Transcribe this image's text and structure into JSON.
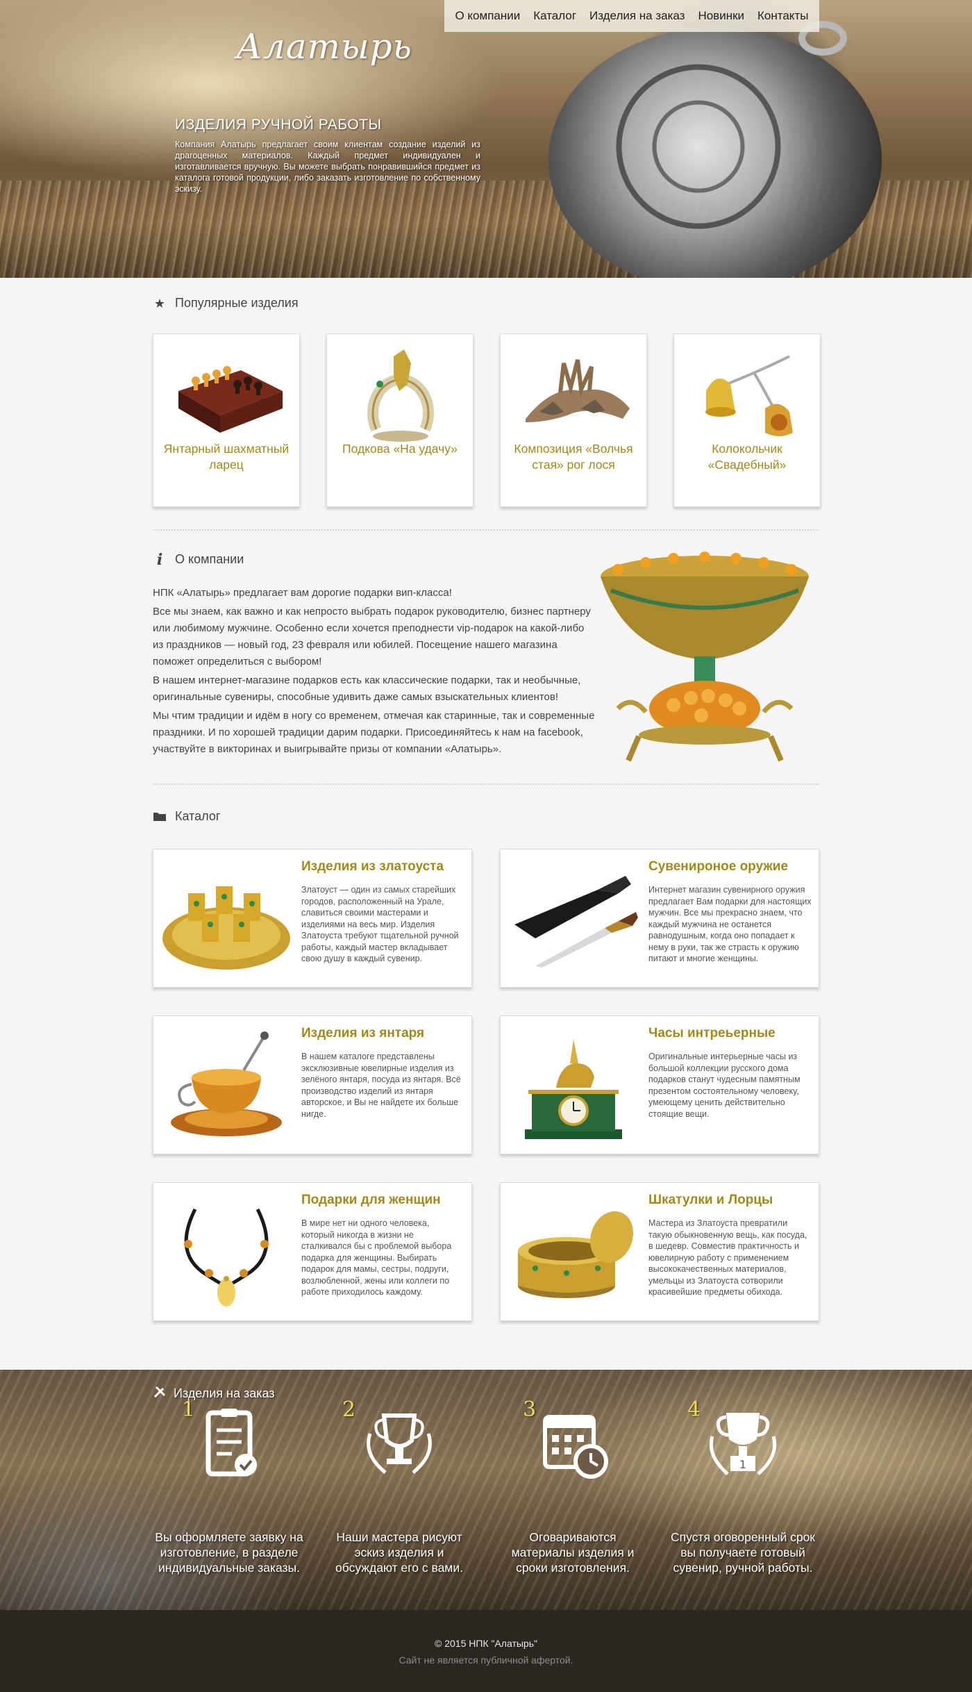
{
  "header": {
    "logo": "Алатырь",
    "nav": [
      "О компании",
      "Каталог",
      "Изделия на заказ",
      "Новинки",
      "Контакты"
    ],
    "hero_title": "ИЗДЕЛИЯ РУЧНОЙ РАБОТЫ",
    "hero_text": "Компания Алатырь предлагает своим клиентам создание изделий из драгоценных материалов. Каждый предмет индивидуален и изготавливается вручную. Вы можете выбрать понравившийся предмет из каталога готовой продукции, либо заказать изготовление по собственному эскизу."
  },
  "popular": {
    "title": "Популярные изделия",
    "icon": "star-icon",
    "items": [
      {
        "label": "Янтарный шахматный ларец"
      },
      {
        "label": "Подкова «На удачу»"
      },
      {
        "label": "Композиция «Волчья стая» рог лося"
      },
      {
        "label": "Колокольчик «Свадебный»"
      }
    ]
  },
  "about": {
    "title": "О компании",
    "icon": "info-icon",
    "paragraphs": [
      "НПК «Алатырь» предлагает вам дорогие подарки вип-класса!",
      "Все мы знаем, как важно и как непросто выбрать подарок руководителю, бизнес партнеру или любимому мужчине. Особенно если хочется преподнести vip-подарок на какой-либо из праздников — новый год, 23 февраля или юбилей. Посещение нашего магазина поможет определиться с выбором!",
      "В нашем интернет-магазине подарков есть как классические подарки, так и необычные, оригинальные сувениры, способные удивить даже самых взыскательных клиентов!",
      "Мы чтим традиции и идём в ногу со временем, отмечая как старинные, так и современные праздники. И по хорошей традиции дарим подарки. Присоединяйтесь к нам на facebook, участвуйте в викторинах и выигрывайте призы от компании «Алатырь»."
    ]
  },
  "catalog": {
    "title": "Каталог",
    "icon": "folder-icon",
    "items": [
      {
        "title": "Изделия из златоуста",
        "desc": "Златоуст — один из самых старейших городов, расположенный на Урале, славиться своими мастерами и изделиями на весь мир. Изделия Златоуста требуют тщательной ручной работы, каждый мастер вкладывает свою душу в каждый сувенир."
      },
      {
        "title": "Сувенироное оружие",
        "desc": "Интернет магазин сувенирного оружия предлагает Вам подарки для настоящих мужчин. Все мы прекрасно знаем, что каждый мужчина не останется равнодушным, когда оно попадает к нему в руки, так же страсть к оружию питают и многие женщины."
      },
      {
        "title": "Изделия из янтаря",
        "desc": "В нашем каталоге представлены эксклюзивные ювелирные изделия из зелёного янтаря, посуда из янтаря. Всё производство изделий из янтаря авторское, и Вы не найдете их больше нигде."
      },
      {
        "title": "Часы интреьерные",
        "desc": "Оригинальные интерьерные часы из большой коллекции русского дома подарков станут чудесным памятным презентом состоятельному человеку, умеющему ценить действительно стоящие вещи."
      },
      {
        "title": "Подарки для женщин",
        "desc": "В мире нет ни одного человека, который никогда в жизни не сталкивался бы с проблемой выбора подарка для женщины. Выбирать подарок для мамы, сестры, подруги, возлюбленной, жены или коллеги по работе приходилось каждому."
      },
      {
        "title": "Шкатулки и Лорцы",
        "desc": "Мастера из Златоуста превратили такую обыкновенную вещь, как посуда, в шедевр. Совместив практичность и ювелирную работу с применением высококачественных материалов, умельцы из Златоуста сотворили красивейшие предметы обихода."
      }
    ]
  },
  "order": {
    "title": "Изделия на заказ",
    "icon": "tools-icon",
    "steps": [
      {
        "num": "1",
        "icon": "clipboard-check-icon",
        "text": "Вы оформляете заявку на изготовление, в разделе индивидуальные заказы."
      },
      {
        "num": "2",
        "icon": "trophy-laurel-icon",
        "text": "Наши мастера рисуют эскиз изделия и обсуждают его с вами."
      },
      {
        "num": "3",
        "icon": "calendar-clock-icon",
        "text": "Оговариваются материалы изделия и сроки изготовления."
      },
      {
        "num": "4",
        "icon": "trophy-first-icon",
        "text": "Спустя оговоренный срок вы получаете готовый сувенир, ручной работы."
      }
    ]
  },
  "footer": {
    "copyright": "© 2015 НПК \"Алатырь\"",
    "note": "Сайт не является публичной афертой."
  }
}
